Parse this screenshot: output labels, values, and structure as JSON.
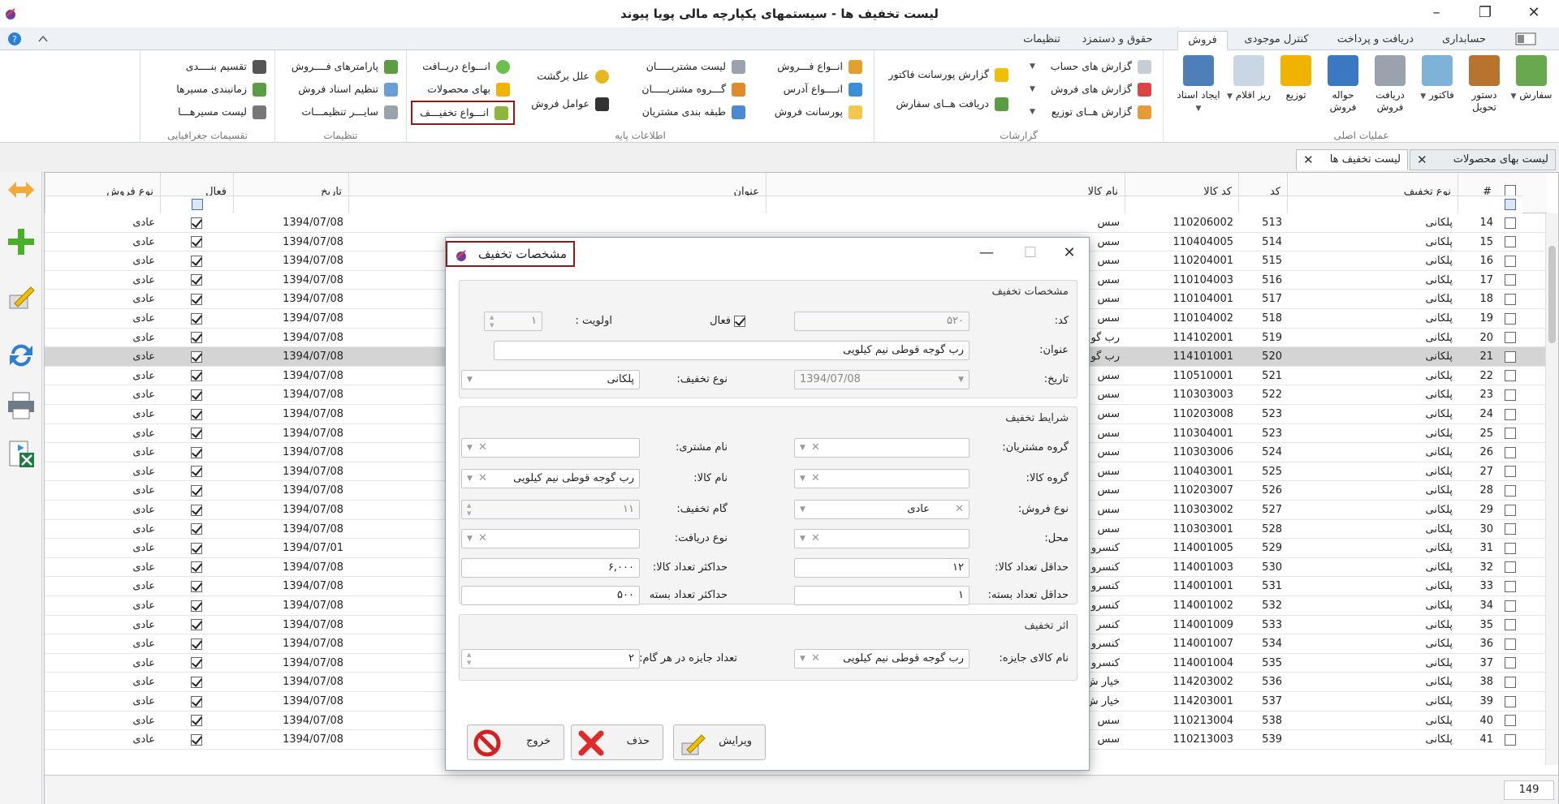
{
  "window": {
    "title": "لیست تخفیف ها - سیستمهای یکپارچه مالی پویا پیوند",
    "minimize": "–",
    "maximize": "❐",
    "close": "✕"
  },
  "ribbon_tabs": [
    "حسابداری",
    "دریافت و پرداخت",
    "کنترل موجودی",
    "فروش",
    "حقوق و دستمزد",
    "تنظیمات"
  ],
  "ribbon": {
    "main_ops": {
      "label": "عملیات اصلی",
      "buttons": [
        "سفارش",
        "دستور تحویل",
        "فاکتور",
        "دریافت فروش",
        "حواله فروش",
        "توزیع",
        "ریز اقلام",
        "ایجاد اسناد"
      ]
    },
    "reports": {
      "label": "گزارشات",
      "items": [
        "گزارش های حساب",
        "گزارش های فروش",
        "گزارش هــای توزیع",
        "گزارش پورسانت فاکتور",
        "دریافت هــای سفارش"
      ]
    },
    "base_info": {
      "label": "اطلاعات پایه",
      "items": [
        "انــواع فـــروش",
        "انــــواع آدرس",
        "پورسانت فروش",
        "لیست مشتریـــــان",
        "گـــروه مشتریـــــان",
        "طبقه بندی مشتریان",
        "علل برگشت",
        "عوامل فروش",
        "انـــواع دریــافت",
        "بهای محصولات",
        "انـــواع تخفیـــف"
      ]
    },
    "settings": {
      "label": "تنظیمات",
      "items": [
        "پارامترهای فــــروش",
        "تنظیم اسناد فروش",
        "سایـــر تنظیمـــات"
      ]
    },
    "geo": {
      "label": "تقسیمات جغرافیایی",
      "items": [
        "تقسیم بنــــدی",
        "زمانبندی مسیرها",
        "لیست مسیرهـــا"
      ]
    }
  },
  "doc_tabs": [
    {
      "label": "لیست بهای محصولات",
      "close": "✕"
    },
    {
      "label": "لیست تخفیف ها",
      "close": "✕"
    }
  ],
  "grid": {
    "columns": [
      "#",
      "نوع تخفیف",
      "کد",
      "کد کالا",
      "نام کالا",
      "عنوان",
      "تاریخ",
      "فعال",
      "نوع فروش"
    ],
    "rows": [
      {
        "n": "14",
        "type": "پلکانی",
        "code": "513",
        "item": "110206002",
        "name": "سس",
        "date": "1394/07/08",
        "sale": "عادی"
      },
      {
        "n": "15",
        "type": "پلکانی",
        "code": "514",
        "item": "110404005",
        "name": "سس",
        "date": "1394/07/08",
        "sale": "عادی"
      },
      {
        "n": "16",
        "type": "پلکانی",
        "code": "515",
        "item": "110204001",
        "name": "سس",
        "date": "1394/07/08",
        "sale": "عادی"
      },
      {
        "n": "17",
        "type": "پلکانی",
        "code": "516",
        "item": "110104003",
        "name": "سس",
        "date": "1394/07/08",
        "sale": "عادی"
      },
      {
        "n": "18",
        "type": "پلکانی",
        "code": "517",
        "item": "110104001",
        "name": "سس",
        "date": "1394/07/08",
        "sale": "عادی"
      },
      {
        "n": "19",
        "type": "پلکانی",
        "code": "518",
        "item": "110104002",
        "name": "سس",
        "date": "1394/07/08",
        "sale": "عادی"
      },
      {
        "n": "20",
        "type": "پلکانی",
        "code": "519",
        "item": "114102001",
        "name": "رب گو",
        "date": "1394/07/08",
        "sale": "عادی"
      },
      {
        "n": "21",
        "type": "پلکانی",
        "code": "520",
        "item": "114101001",
        "name": "رب گو",
        "date": "1394/07/08",
        "sale": "عادی"
      },
      {
        "n": "22",
        "type": "پلکانی",
        "code": "521",
        "item": "110510001",
        "name": "سس",
        "date": "1394/07/08",
        "sale": "عادی"
      },
      {
        "n": "23",
        "type": "پلکانی",
        "code": "522",
        "item": "110303003",
        "name": "سس",
        "date": "1394/07/08",
        "sale": "عادی"
      },
      {
        "n": "24",
        "type": "پلکانی",
        "code": "523",
        "item": "110203008",
        "name": "سس",
        "date": "1394/07/08",
        "sale": "عادی"
      },
      {
        "n": "25",
        "type": "پلکانی",
        "code": "523",
        "item": "110304001",
        "name": "سس",
        "date": "1394/07/08",
        "sale": "عادی"
      },
      {
        "n": "26",
        "type": "پلکانی",
        "code": "524",
        "item": "110303006",
        "name": "سس",
        "date": "1394/07/08",
        "sale": "عادی"
      },
      {
        "n": "27",
        "type": "پلکانی",
        "code": "525",
        "item": "110403001",
        "name": "سس",
        "date": "1394/07/08",
        "sale": "عادی"
      },
      {
        "n": "28",
        "type": "پلکانی",
        "code": "526",
        "item": "110203007",
        "name": "سس",
        "date": "1394/07/08",
        "sale": "عادی"
      },
      {
        "n": "29",
        "type": "پلکانی",
        "code": "527",
        "item": "110303002",
        "name": "سس",
        "date": "1394/07/08",
        "sale": "عادی"
      },
      {
        "n": "30",
        "type": "پلکانی",
        "code": "528",
        "item": "110303001",
        "name": "سس",
        "date": "1394/07/08",
        "sale": "عادی"
      },
      {
        "n": "31",
        "type": "پلکانی",
        "code": "529",
        "item": "114001005",
        "name": "کنسرو",
        "date": "1394/07/01",
        "sale": "عادی"
      },
      {
        "n": "32",
        "type": "پلکانی",
        "code": "530",
        "item": "114001003",
        "name": "کنسرو",
        "date": "1394/07/08",
        "sale": "عادی"
      },
      {
        "n": "33",
        "type": "پلکانی",
        "code": "531",
        "item": "114001001",
        "name": "کنسرو",
        "date": "1394/07/08",
        "sale": "عادی"
      },
      {
        "n": "34",
        "type": "پلکانی",
        "code": "532",
        "item": "114001002",
        "name": "کنسرو",
        "date": "1394/07/08",
        "sale": "عادی"
      },
      {
        "n": "35",
        "type": "پلکانی",
        "code": "533",
        "item": "114001009",
        "name": "کنسر",
        "date": "1394/07/08",
        "sale": "عادی"
      },
      {
        "n": "36",
        "type": "پلکانی",
        "code": "534",
        "item": "114001007",
        "name": "کنسرو",
        "date": "1394/07/08",
        "sale": "عادی"
      },
      {
        "n": "37",
        "type": "پلکانی",
        "code": "535",
        "item": "114001004",
        "name": "کنسرو",
        "date": "1394/07/08",
        "sale": "عادی"
      },
      {
        "n": "38",
        "type": "پلکانی",
        "code": "536",
        "item": "114203002",
        "name": "خیار ش",
        "date": "1394/07/08",
        "sale": "عادی"
      },
      {
        "n": "39",
        "type": "پلکانی",
        "code": "537",
        "item": "114203001",
        "name": "خیار ش",
        "date": "1394/07/08",
        "sale": "عادی"
      },
      {
        "n": "40",
        "type": "پلکانی",
        "code": "538",
        "item": "110213004",
        "name": "سس",
        "date": "1394/07/08",
        "sale": "عادی"
      },
      {
        "n": "41",
        "type": "پلکانی",
        "code": "539",
        "item": "110213003",
        "name": "سس",
        "date": "1394/07/08",
        "sale": "عادی"
      }
    ],
    "selected_row": "21",
    "row_count": "149"
  },
  "dialog": {
    "title": "مشخصات تخفیف",
    "close": "✕",
    "minimize": "—",
    "maximize": "☐",
    "section1": {
      "label": "مشخصات تخفیف",
      "code_label": "کد:",
      "code_value": "۵۲۰",
      "active_label": "فعال",
      "priority_label": "اولویت :",
      "priority_value": "۱",
      "title_label": "عنوان:",
      "title_value": "رب گوجه قوطی نیم کیلویی",
      "date_label": "تاریخ:",
      "date_value": "1394/07/08",
      "type_label": "نوع تخفیف:",
      "type_value": "پلکانی"
    },
    "section2": {
      "label": "شرایط تخفیف",
      "cust_group_label": "گروه مشتریان:",
      "cust_name_label": "نام مشتری:",
      "item_group_label": "گروه کالا:",
      "item_name_label": "نام کالا:",
      "item_name_value": "رب گوجه قوطی نیم کیلویی",
      "sale_type_label": "نوع فروش:",
      "sale_type_value": "عادی",
      "step_label": "گام تخفیف:",
      "step_value": "۱۱",
      "place_label": "محل:",
      "receive_type_label": "نوع دریافت:",
      "min_qty_label": "حداقل تعداد کالا:",
      "min_qty_value": "۱۲",
      "max_qty_label": "حداکثر تعداد کالا:",
      "max_qty_value": "۶,۰۰۰",
      "min_pack_label": "حداقل تعداد بسته:",
      "min_pack_value": "۱",
      "max_pack_label": "حداکثر تعداد بسته",
      "max_pack_value": "۵۰۰"
    },
    "section3": {
      "label": "اثر تخفیف",
      "gift_item_label": "نام کالای جایزه:",
      "gift_item_value": "رب گوجه قوطی نیم کیلویی",
      "gift_count_label": "تعداد جایزه در هر گام:",
      "gift_count_value": "۲"
    },
    "buttons": {
      "edit": "ویرایش",
      "delete": "حذف",
      "exit": "خروج"
    }
  },
  "colors": {
    "highlight": "#8e1b1b",
    "selected_row": "#d4d4d4",
    "ribbon_active": "#ffffff"
  }
}
